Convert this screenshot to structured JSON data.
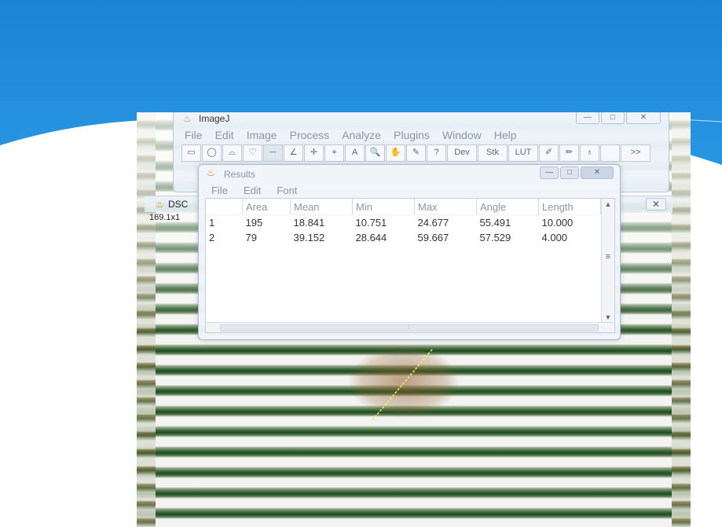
{
  "colors": {
    "slide_blue": "#1e88d6",
    "slide_blue_light": "#41a8ee",
    "measure_line": "#f0f060"
  },
  "imagej": {
    "title": "ImageJ",
    "logo_icon": "microscope-icon",
    "menu": [
      "File",
      "Edit",
      "Image",
      "Process",
      "Analyze",
      "Plugins",
      "Window",
      "Help"
    ],
    "tools": [
      {
        "icon": "rectangle-tool-icon",
        "glyph": "▭"
      },
      {
        "icon": "oval-tool-icon",
        "glyph": "◯"
      },
      {
        "icon": "polygon-tool-icon",
        "glyph": "⌓"
      },
      {
        "icon": "freehand-tool-icon",
        "glyph": "♡"
      },
      {
        "icon": "line-tool-icon",
        "glyph": "─",
        "selected": true
      },
      {
        "icon": "angle-tool-icon",
        "glyph": "∠"
      },
      {
        "icon": "point-tool-icon",
        "glyph": "✛"
      },
      {
        "icon": "wand-tool-icon",
        "glyph": "⌖"
      },
      {
        "icon": "text-tool-icon",
        "glyph": "A"
      },
      {
        "icon": "zoom-tool-icon",
        "glyph": "🔍"
      },
      {
        "icon": "hand-tool-icon",
        "glyph": "✋"
      },
      {
        "icon": "dropper-tool-icon",
        "glyph": "✎"
      },
      {
        "icon": "help-tool-icon",
        "glyph": "?"
      },
      {
        "label": "Dev"
      },
      {
        "label": "Stk"
      },
      {
        "label": "LUT"
      },
      {
        "icon": "brush-tool-icon",
        "glyph": "✐"
      },
      {
        "icon": "pencil-tool-icon",
        "glyph": "✏"
      },
      {
        "icon": "flood-fill-tool-icon",
        "glyph": "♁"
      },
      {
        "icon": "blank-tool-icon",
        "glyph": ""
      },
      {
        "label": ">>"
      }
    ]
  },
  "image_window": {
    "title": "DSC",
    "info": "169.1x1",
    "close_glyph": "✕"
  },
  "results": {
    "title": "Results",
    "menu": [
      "File",
      "Edit",
      "Font"
    ],
    "columns": [
      "",
      "Area",
      "Mean",
      "Min",
      "Max",
      "Angle",
      "Length"
    ],
    "rows": [
      [
        "1",
        "195",
        "18.841",
        "10.751",
        "24.677",
        "55.491",
        "10.000"
      ],
      [
        "2",
        "79",
        "39.152",
        "28.644",
        "59.667",
        "57.529",
        "4.000"
      ]
    ],
    "scroll_mid_glyph": "≡",
    "hscroll_glyph": "⁞"
  },
  "window_buttons": {
    "minimize": "—",
    "maximize": "□",
    "close": "✕"
  }
}
